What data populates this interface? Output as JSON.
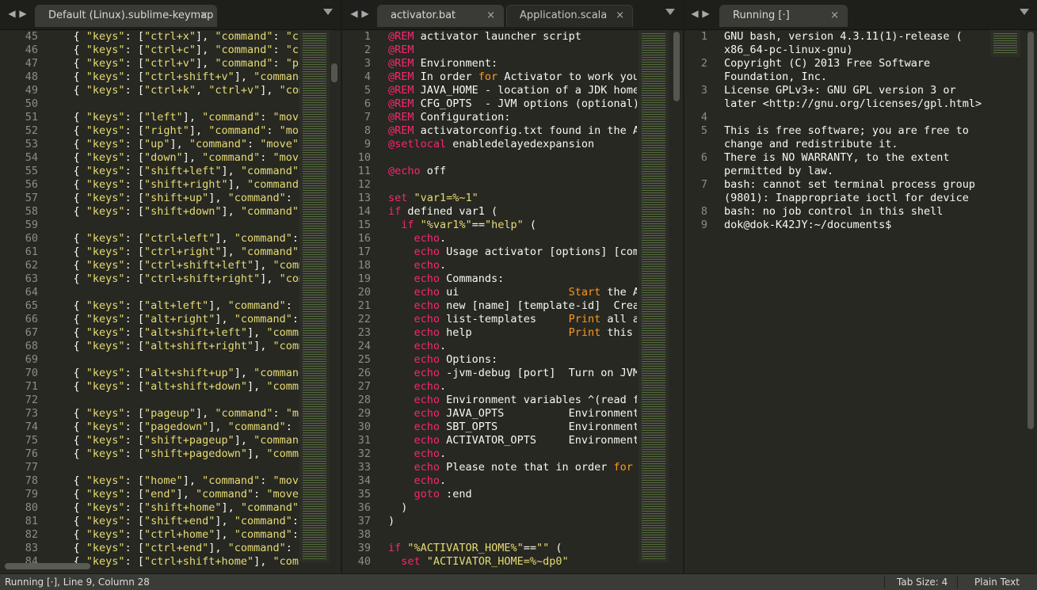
{
  "panes": {
    "left": {
      "tab_label": "Default (Linux).sublime-keymap",
      "gutter_start": 45,
      "lines": [
        "    { \"keys\": [\"ctrl+x\"], \"command\": \"cu",
        "    { \"keys\": [\"ctrl+c\"], \"command\": \"co",
        "    { \"keys\": [\"ctrl+v\"], \"command\": \"pa",
        "    { \"keys\": [\"ctrl+shift+v\"], \"command",
        "    { \"keys\": [\"ctrl+k\", \"ctrl+v\"], \"com",
        "",
        "    { \"keys\": [\"left\"], \"command\": \"move",
        "    { \"keys\": [\"right\"], \"command\": \"mov",
        "    { \"keys\": [\"up\"], \"command\": \"move\",",
        "    { \"keys\": [\"down\"], \"command\": \"move",
        "    { \"keys\": [\"shift+left\"], \"command\"",
        "    { \"keys\": [\"shift+right\"], \"command\"",
        "    { \"keys\": [\"shift+up\"], \"command\": ",
        "    { \"keys\": [\"shift+down\"], \"command\"",
        "",
        "    { \"keys\": [\"ctrl+left\"], \"command\": ",
        "    { \"keys\": [\"ctrl+right\"], \"command\":",
        "    { \"keys\": [\"ctrl+shift+left\"], \"comm",
        "    { \"keys\": [\"ctrl+shift+right\"], \"com",
        "",
        "    { \"keys\": [\"alt+left\"], \"command\": ",
        "    { \"keys\": [\"alt+right\"], \"command\":",
        "    { \"keys\": [\"alt+shift+left\"], \"comma",
        "    { \"keys\": [\"alt+shift+right\"], \"comm",
        "",
        "    { \"keys\": [\"alt+shift+up\"], \"command",
        "    { \"keys\": [\"alt+shift+down\"], \"comma",
        "",
        "    { \"keys\": [\"pageup\"], \"command\": \"mo",
        "    { \"keys\": [\"pagedown\"], \"command\": ",
        "    { \"keys\": [\"shift+pageup\"], \"command",
        "    { \"keys\": [\"shift+pagedown\"], \"comma",
        "",
        "    { \"keys\": [\"home\"], \"command\": \"move",
        "    { \"keys\": [\"end\"], \"command\": \"move",
        "    { \"keys\": [\"shift+home\"], \"command\":",
        "    { \"keys\": [\"shift+end\"], \"command\": ",
        "    { \"keys\": [\"ctrl+home\"], \"command\": ",
        "    { \"keys\": [\"ctrl+end\"], \"command\": ",
        "    { \"keys\": [\"ctrl+shift+home\"], \"com"
      ]
    },
    "middle": {
      "tab_active": "activator.bat",
      "tab_inactive": "Application.scala",
      "gutter_start": 1,
      "lines": [
        "@REM activator launcher script",
        "@REM",
        "@REM Environment:",
        "@REM In order for Activator to work you",
        "@REM JAVA_HOME - location of a JDK home",
        "@REM CFG_OPTS  - JVM options (optional)",
        "@REM Configuration:",
        "@REM activatorconfig.txt found in the AC",
        "@setlocal enabledelayedexpansion",
        "",
        "@echo off",
        "",
        "set \"var1=%~1\"",
        "if defined var1 (",
        "  if \"%var1%\"==\"help\" (",
        "    echo.",
        "    echo Usage activator [options] [comm",
        "    echo.",
        "    echo Commands:",
        "    echo ui                 Start the Ac",
        "    echo new [name] [template-id]  Creat",
        "    echo list-templates     Print all av",
        "    echo help               Print this m",
        "    echo.",
        "    echo Options:",
        "    echo -jvm-debug [port]  Turn on JVM",
        "    echo.",
        "    echo Environment variables ^(read fr",
        "    echo JAVA_OPTS          Environment",
        "    echo SBT_OPTS           Environment",
        "    echo ACTIVATOR_OPTS     Environment",
        "    echo.",
        "    echo Please note that in order for A",
        "    echo.",
        "    goto :end",
        "  )",
        ")",
        "",
        "if \"%ACTIVATOR_HOME%\"==\"\" (",
        "  set \"ACTIVATOR_HOME=%~dp0\""
      ]
    },
    "right": {
      "tab_label": "Running [·]",
      "gutter": [
        "1",
        "",
        "2",
        "",
        "3",
        "",
        "4",
        "5",
        "",
        "6",
        "",
        "7",
        "",
        "8",
        "9"
      ],
      "lines": [
        "GNU bash, version 4.3.11(1)-release (",
        "x86_64-pc-linux-gnu)",
        "Copyright (C) 2013 Free Software",
        "Foundation, Inc.",
        "License GPLv3+: GNU GPL version 3 or",
        "later <http://gnu.org/licenses/gpl.html>",
        "",
        "This is free software; you are free to",
        "change and redistribute it.",
        "There is NO WARRANTY, to the extent",
        "permitted by law.",
        "bash: cannot set terminal process group",
        "(9801): Inappropriate ioctl for device",
        "bash: no job control in this shell",
        "dok@dok-K42JY:~/documents$"
      ]
    }
  },
  "statusbar": {
    "left": "Running [·], Line 9, Column 28",
    "tab_size": "Tab Size: 4",
    "syntax": "Plain Text"
  }
}
